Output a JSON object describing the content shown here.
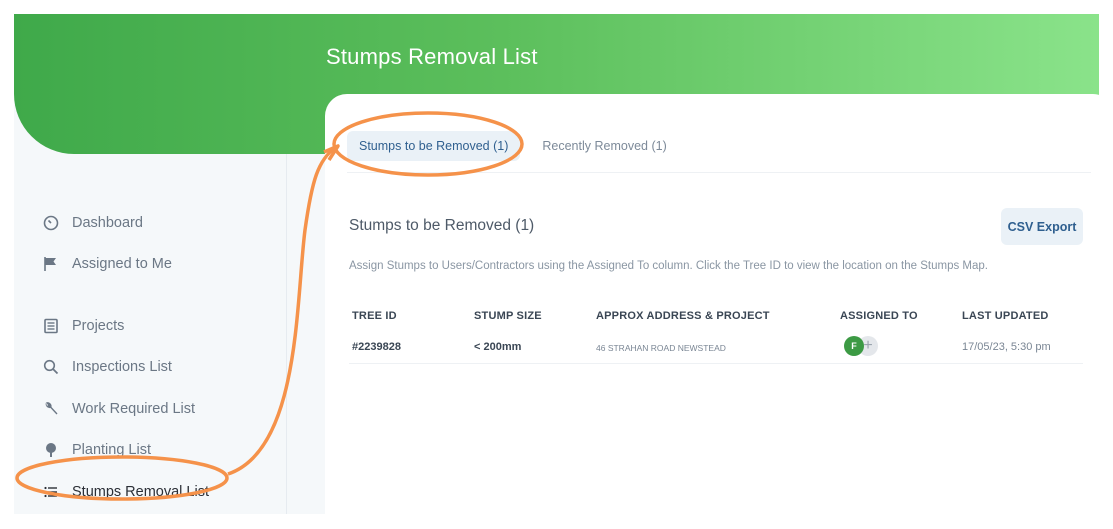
{
  "header": {
    "title": "Stumps Removal List"
  },
  "sidebar": {
    "items": [
      {
        "label": "Dashboard",
        "icon": "dashboard-gauge-icon"
      },
      {
        "label": "Assigned to Me",
        "icon": "flag-icon"
      },
      {
        "label": "Projects",
        "icon": "document-list-icon"
      },
      {
        "label": "Inspections List",
        "icon": "search-icon"
      },
      {
        "label": "Work Required List",
        "icon": "wrench-icon"
      },
      {
        "label": "Planting List",
        "icon": "tree-icon"
      },
      {
        "label": "Stumps Removal List",
        "icon": "list-icon",
        "active": true
      }
    ]
  },
  "tabs": [
    {
      "label": "Stumps to be Removed (1)",
      "active": true
    },
    {
      "label": "Recently Removed (1)",
      "active": false
    }
  ],
  "section": {
    "title": "Stumps to be Removed (1)",
    "csv_button": "CSV Export",
    "description": "Assign Stumps to Users/Contractors using the Assigned To column. Click the Tree ID to view the location on the Stumps Map."
  },
  "table": {
    "headers": [
      "TREE ID",
      "STUMP SIZE",
      "APPROX ADDRESS & PROJECT",
      "ASSIGNED TO",
      "LAST UPDATED"
    ],
    "rows": [
      {
        "tree_id": "#2239828",
        "stump_size": "< 200mm",
        "address": "46 STRAHAN ROAD NEWSTEAD",
        "assigned_initial": "F",
        "add_symbol": "+",
        "last_updated": "17/05/23, 5:30 pm"
      }
    ]
  },
  "colors": {
    "header_start": "#3fa94a",
    "header_end": "#8ae38a",
    "annotation": "#f5924a",
    "tab_active_bg": "#eaf1f7",
    "tab_active_text": "#2f5f8f",
    "avatar": "#3c9a44"
  }
}
